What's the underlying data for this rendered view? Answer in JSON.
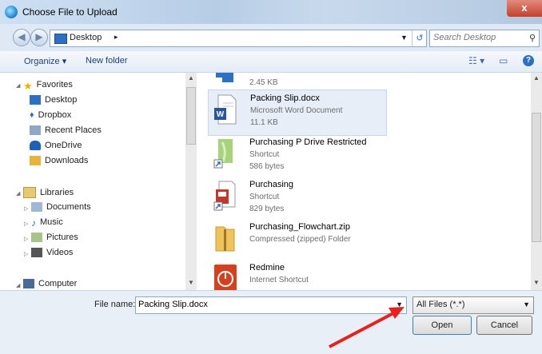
{
  "window": {
    "title": "Choose File to Upload",
    "close_glyph": "x"
  },
  "address": {
    "location": "Desktop",
    "separator": "▸",
    "search_placeholder": "Search Desktop"
  },
  "toolbar": {
    "organize_label": "Organize ▾",
    "new_folder_label": "New folder"
  },
  "nav": {
    "favorites": {
      "label": "Favorites",
      "items": [
        "Desktop",
        "Dropbox",
        "Recent Places",
        "OneDrive",
        "Downloads"
      ]
    },
    "libraries": {
      "label": "Libraries",
      "items": [
        "Documents",
        "Music",
        "Pictures",
        "Videos"
      ]
    },
    "computer_label": "Computer"
  },
  "files": [
    {
      "name": "",
      "type": "",
      "size": "2.45 KB",
      "icon": "file-icon",
      "selected": false
    },
    {
      "name": "Packing Slip.docx",
      "type": "Microsoft Word Document",
      "size": "11.1 KB",
      "icon": "word-document-icon",
      "selected": true
    },
    {
      "name": "Purchasing P Drive Restricted",
      "type": "Shortcut",
      "size": "586 bytes",
      "icon": "shortcut-icon",
      "selected": false
    },
    {
      "name": "Purchasing",
      "type": "Shortcut",
      "size": "829 bytes",
      "icon": "shortcut-icon",
      "selected": false
    },
    {
      "name": "Purchasing_Flowchart.zip",
      "type": "Compressed (zipped) Folder",
      "size": "",
      "icon": "zip-folder-icon",
      "selected": false
    },
    {
      "name": "Redmine",
      "type": "Internet Shortcut",
      "size": "",
      "icon": "internet-shortcut-icon",
      "selected": false
    }
  ],
  "bottom": {
    "file_name_label": "File name:",
    "file_name_value": "Packing Slip.docx",
    "file_type_value": "All Files (*.*)",
    "open_label": "Open",
    "cancel_label": "Cancel"
  },
  "colors": {
    "accent": "#2d6fc2",
    "annotation_arrow": "#e8201e"
  }
}
